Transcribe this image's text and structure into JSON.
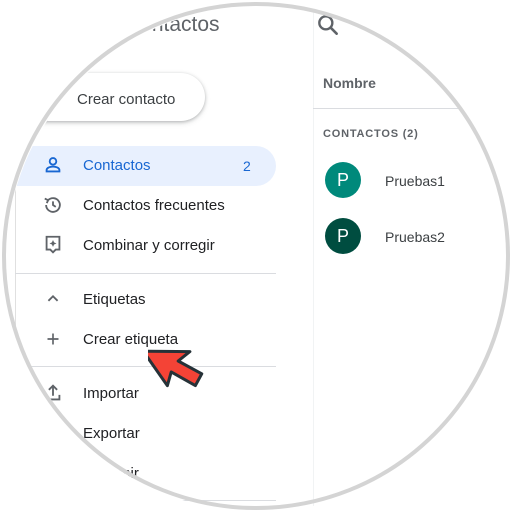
{
  "app": {
    "title": "Contactos"
  },
  "create_button": {
    "label": "Crear contacto"
  },
  "nav": {
    "contacts": {
      "label": "Contactos",
      "count": "2",
      "icon": "person-icon"
    },
    "frequent": {
      "label": "Contactos frecuentes",
      "icon": "history-icon"
    },
    "merge": {
      "label": "Combinar y corregir",
      "icon": "merge-icon"
    },
    "labels": {
      "label": "Etiquetas",
      "icon": "chevron-up-icon"
    },
    "create_label": {
      "label": "Crear etiqueta",
      "icon": "plus-icon"
    },
    "import": {
      "label": "Importar",
      "icon": "upload-icon"
    },
    "export": {
      "label": "Exportar"
    },
    "print": {
      "label": "mir"
    }
  },
  "list": {
    "column_header": "Nombre",
    "section_label": "CONTACTOS (2)",
    "contacts": [
      {
        "initial": "P",
        "name": "Pruebas1",
        "color": "#00897b"
      },
      {
        "initial": "P",
        "name": "Pruebas2",
        "color": "#004d40"
      }
    ]
  },
  "colors": {
    "accent": "#1967d2",
    "active_bg": "#e8f0fe",
    "cursor_red": "#f44336"
  }
}
